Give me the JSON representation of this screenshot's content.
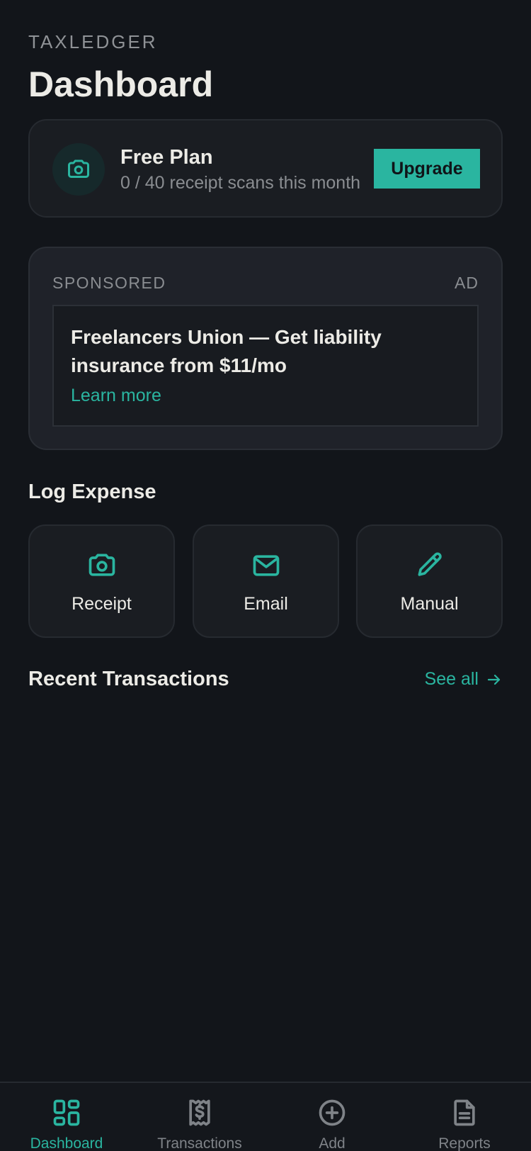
{
  "app": {
    "brand": "TAXLEDGER",
    "page_title": "Dashboard"
  },
  "plan": {
    "name": "Free Plan",
    "usage": "0 / 40 receipt scans this month",
    "upgrade_label": "Upgrade",
    "icon": "camera-icon"
  },
  "sponsored": {
    "label": "SPONSORED",
    "tag": "AD",
    "headline": "Freelancers Union — Get liability insurance from $11/mo",
    "link": "Learn more"
  },
  "log_expense": {
    "title": "Log Expense",
    "options": [
      {
        "label": "Receipt",
        "icon": "camera-icon"
      },
      {
        "label": "Email",
        "icon": "mail-icon"
      },
      {
        "label": "Manual",
        "icon": "pencil-icon"
      }
    ]
  },
  "recent": {
    "title": "Recent Transactions",
    "see_all": "See all"
  },
  "nav": {
    "items": [
      {
        "label": "Dashboard",
        "icon": "grid-icon",
        "active": true
      },
      {
        "label": "Transactions",
        "icon": "receipt-dollar-icon",
        "active": false
      },
      {
        "label": "Add",
        "icon": "plus-circle-icon",
        "active": false
      },
      {
        "label": "Reports",
        "icon": "document-icon",
        "active": false
      }
    ]
  },
  "colors": {
    "background": "#12151a",
    "accent": "#2ab5a0",
    "card": "#1a1d22",
    "muted_text": "#8a8d91"
  }
}
